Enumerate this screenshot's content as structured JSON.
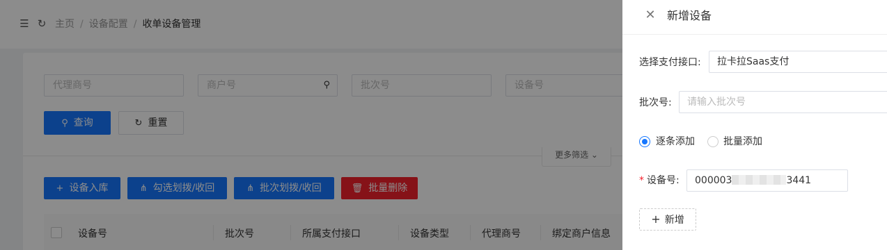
{
  "header": {
    "breadcrumb": [
      "主页",
      "设备配置",
      "收单设备管理"
    ],
    "separator": "/",
    "menu_icon": "indent-menu-icon",
    "refresh_icon": "refresh-icon"
  },
  "filters": {
    "agent_placeholder": "代理商号",
    "merchant_placeholder": "商户号",
    "batch_placeholder": "批次号",
    "device_placeholder": "设备号",
    "query_label": "查询",
    "reset_label": "重置",
    "more_label": "更多筛选 ⌄"
  },
  "actions": {
    "stock_in_label": "设备入库",
    "select_allocate_label": "勾选划拨/收回",
    "batch_allocate_label": "批次划拨/收回",
    "batch_delete_label": "批量删除"
  },
  "table": {
    "columns": [
      "设备号",
      "批次号",
      "所属支付接口",
      "设备类型",
      "代理商号",
      "绑定商户信息"
    ]
  },
  "drawer": {
    "title": "新增设备",
    "payment_label": "选择支付接口:",
    "payment_value": "拉卡拉Saas支付",
    "batch_label": "批次号:",
    "batch_placeholder": "请输入批次号",
    "mode_options": [
      "逐条添加",
      "批量添加"
    ],
    "mode_selected": "逐条添加",
    "device_required_mark": "*",
    "device_label": "设备号:",
    "device_value_prefix": "000003",
    "device_value_suffix": "3441",
    "add_label": "新增"
  },
  "colors": {
    "primary": "#1677ff",
    "danger": "#f5222d",
    "mask": "rgba(0,0,0,0.45)"
  }
}
